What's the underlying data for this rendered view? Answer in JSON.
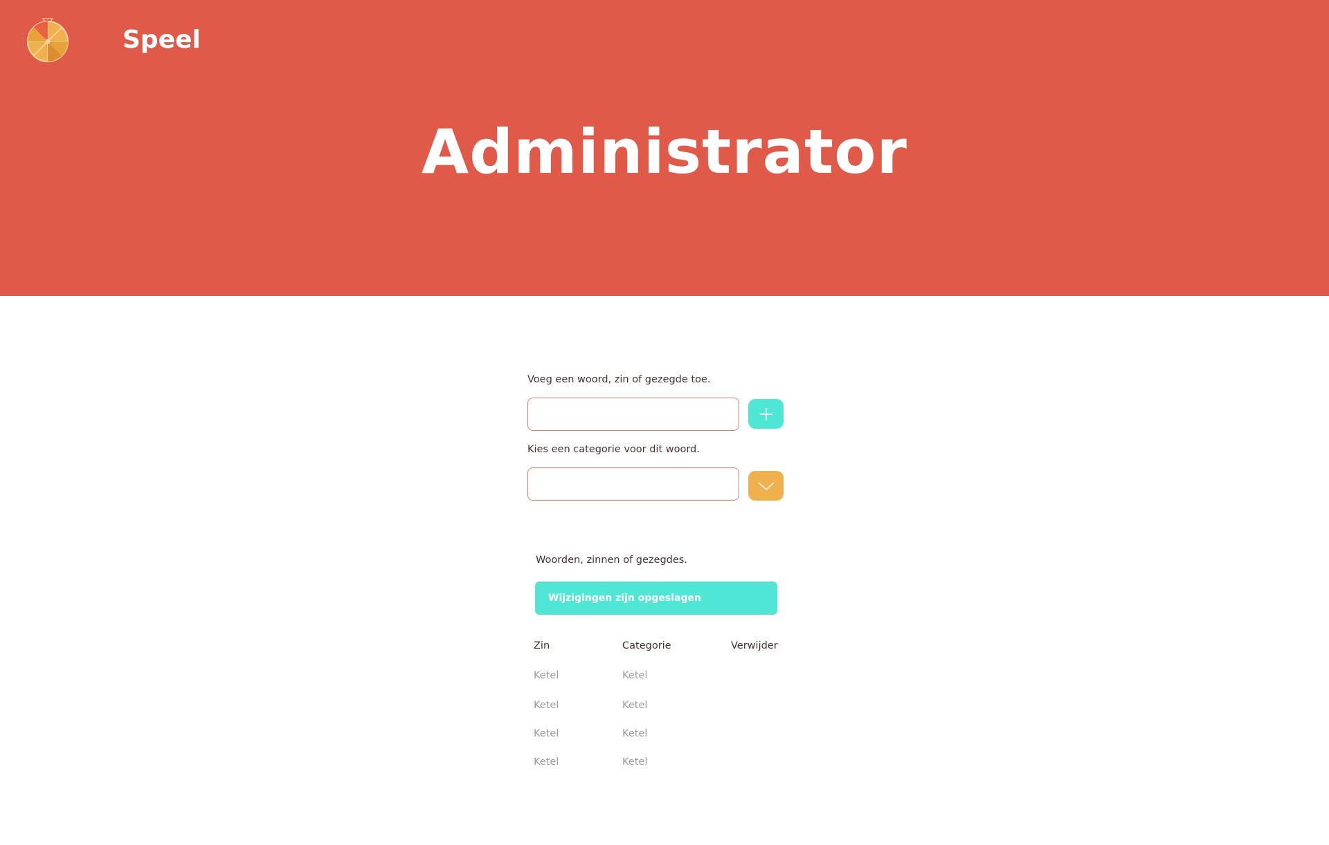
{
  "header": {
    "nav_link": "Speel",
    "title": "Administrator",
    "background_color": "#df5a48"
  },
  "form": {
    "word_label": "Voeg een woord, zin of gezegde  toe.",
    "word_value": "",
    "add_icon": "plus-icon",
    "category_label": "Kies een categorie voor dit woord.",
    "category_value": "",
    "dropdown_icon": "chevron-down-icon"
  },
  "list": {
    "heading": "Woorden, zinnen of gezegdes.",
    "status_message": "Wijzigingen zijn opgeslagen",
    "columns": [
      "Zin",
      "Categorie",
      "Verwijder"
    ],
    "rows": [
      {
        "zin": "Ketel",
        "categorie": "Ketel"
      },
      {
        "zin": "Ketel",
        "categorie": "Ketel"
      },
      {
        "zin": "Ketel",
        "categorie": "Ketel"
      },
      {
        "zin": "Ketel",
        "categorie": "Ketel"
      }
    ]
  },
  "colors": {
    "accent_teal": "#4fe6d6",
    "accent_orange": "#f0b04e",
    "input_border": "#df7a6a"
  }
}
